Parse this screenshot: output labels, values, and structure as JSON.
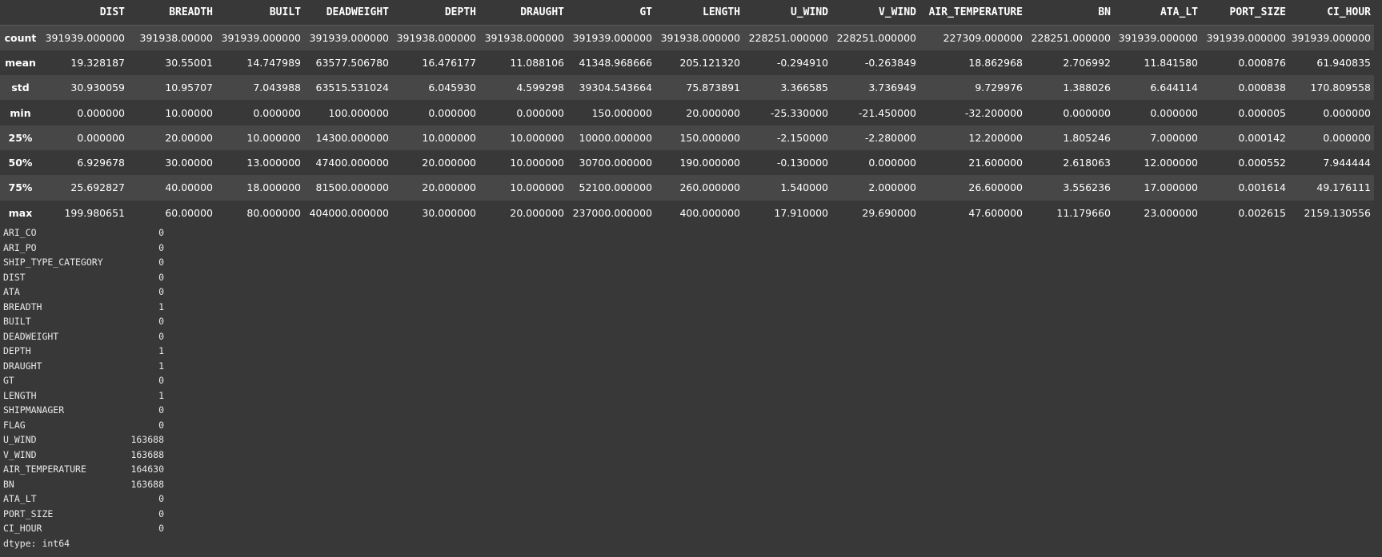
{
  "describe_table": {
    "columns": [
      "DIST",
      "BREADTH",
      "BUILT",
      "DEADWEIGHT",
      "DEPTH",
      "DRAUGHT",
      "GT",
      "LENGTH",
      "U_WIND",
      "V_WIND",
      "AIR_TEMPERATURE",
      "BN",
      "ATA_LT",
      "PORT_SIZE",
      "CI_HOUR"
    ],
    "rows": [
      {
        "label": "count",
        "values": [
          "391939.000000",
          "391938.00000",
          "391939.000000",
          "391939.000000",
          "391938.000000",
          "391938.000000",
          "391939.000000",
          "391938.000000",
          "228251.000000",
          "228251.000000",
          "227309.000000",
          "228251.000000",
          "391939.000000",
          "391939.000000",
          "391939.000000"
        ]
      },
      {
        "label": "mean",
        "values": [
          "19.328187",
          "30.55001",
          "14.747989",
          "63577.506780",
          "16.476177",
          "11.088106",
          "41348.968666",
          "205.121320",
          "-0.294910",
          "-0.263849",
          "18.862968",
          "2.706992",
          "11.841580",
          "0.000876",
          "61.940835"
        ]
      },
      {
        "label": "std",
        "values": [
          "30.930059",
          "10.95707",
          "7.043988",
          "63515.531024",
          "6.045930",
          "4.599298",
          "39304.543664",
          "75.873891",
          "3.366585",
          "3.736949",
          "9.729976",
          "1.388026",
          "6.644114",
          "0.000838",
          "170.809558"
        ]
      },
      {
        "label": "min",
        "values": [
          "0.000000",
          "10.00000",
          "0.000000",
          "100.000000",
          "0.000000",
          "0.000000",
          "150.000000",
          "20.000000",
          "-25.330000",
          "-21.450000",
          "-32.200000",
          "0.000000",
          "0.000000",
          "0.000005",
          "0.000000"
        ]
      },
      {
        "label": "25%",
        "values": [
          "0.000000",
          "20.00000",
          "10.000000",
          "14300.000000",
          "10.000000",
          "10.000000",
          "10000.000000",
          "150.000000",
          "-2.150000",
          "-2.280000",
          "12.200000",
          "1.805246",
          "7.000000",
          "0.000142",
          "0.000000"
        ]
      },
      {
        "label": "50%",
        "values": [
          "6.929678",
          "30.00000",
          "13.000000",
          "47400.000000",
          "20.000000",
          "10.000000",
          "30700.000000",
          "190.000000",
          "-0.130000",
          "0.000000",
          "21.600000",
          "2.618063",
          "12.000000",
          "0.000552",
          "7.944444"
        ]
      },
      {
        "label": "75%",
        "values": [
          "25.692827",
          "40.00000",
          "18.000000",
          "81500.000000",
          "20.000000",
          "10.000000",
          "52100.000000",
          "260.000000",
          "1.540000",
          "2.000000",
          "26.600000",
          "3.556236",
          "17.000000",
          "0.001614",
          "49.176111"
        ]
      },
      {
        "label": "max",
        "values": [
          "199.980651",
          "60.00000",
          "80.000000",
          "404000.000000",
          "30.000000",
          "20.000000",
          "237000.000000",
          "400.000000",
          "17.910000",
          "29.690000",
          "47.600000",
          "11.179660",
          "23.000000",
          "0.002615",
          "2159.130556"
        ]
      }
    ]
  },
  "null_counts": {
    "rows": [
      {
        "name": "ARI_CO",
        "value": "0"
      },
      {
        "name": "ARI_PO",
        "value": "0"
      },
      {
        "name": "SHIP_TYPE_CATEGORY",
        "value": "0"
      },
      {
        "name": "DIST",
        "value": "0"
      },
      {
        "name": "ATA",
        "value": "0"
      },
      {
        "name": "BREADTH",
        "value": "1"
      },
      {
        "name": "BUILT",
        "value": "0"
      },
      {
        "name": "DEADWEIGHT",
        "value": "0"
      },
      {
        "name": "DEPTH",
        "value": "1"
      },
      {
        "name": "DRAUGHT",
        "value": "1"
      },
      {
        "name": "GT",
        "value": "0"
      },
      {
        "name": "LENGTH",
        "value": "1"
      },
      {
        "name": "SHIPMANAGER",
        "value": "0"
      },
      {
        "name": "FLAG",
        "value": "0"
      },
      {
        "name": "U_WIND",
        "value": "163688"
      },
      {
        "name": "V_WIND",
        "value": "163688"
      },
      {
        "name": "AIR_TEMPERATURE",
        "value": "164630"
      },
      {
        "name": "BN",
        "value": "163688"
      },
      {
        "name": "ATA_LT",
        "value": "0"
      },
      {
        "name": "PORT_SIZE",
        "value": "0"
      },
      {
        "name": "CI_HOUR",
        "value": "0"
      }
    ],
    "dtype_line": "dtype: int64"
  },
  "colors": {
    "background": "#383838",
    "row_stripe": "#474747",
    "text": "#ffffff"
  }
}
